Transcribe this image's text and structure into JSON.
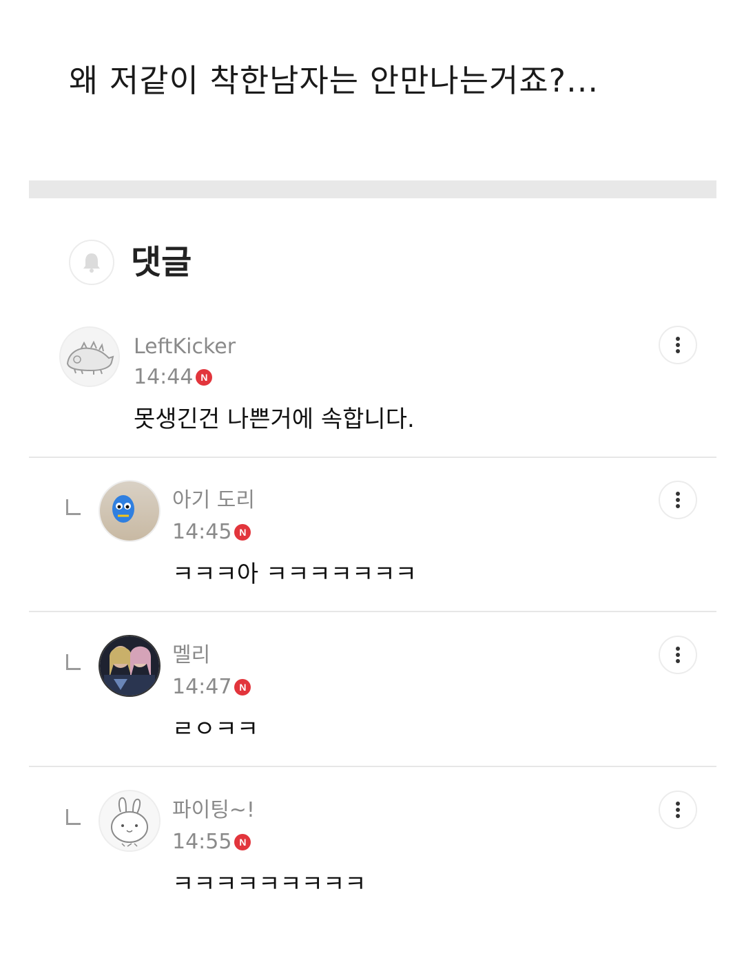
{
  "post": {
    "title": "왜 저같이 착한남자는 안만나는거죠?..."
  },
  "comments_section": {
    "title": "댓글"
  },
  "comments": [
    {
      "author": "LeftKicker",
      "time": "14:44",
      "badge": "N",
      "text": "못생긴건 나쁜거에 속합니다.",
      "is_reply": false
    },
    {
      "author": "아기 도리",
      "time": "14:45",
      "badge": "N",
      "text": "ㅋㅋㅋ아 ㅋㅋㅋㅋㅋㅋㅋ",
      "is_reply": true
    },
    {
      "author": "멜리",
      "time": "14:47",
      "badge": "N",
      "text": "ㄹㅇㅋㅋ",
      "is_reply": true
    },
    {
      "author": "파이팅~!",
      "time": "14:55",
      "badge": "N",
      "text": "ㅋㅋㅋㅋㅋㅋㅋㅋㅋ",
      "is_reply": true
    }
  ],
  "colors": {
    "badge": "#e2353c",
    "meta_text": "#8a8a8a",
    "divider": "#e6e6e6",
    "band": "#e8e8e8"
  },
  "icons": [
    "bell-icon",
    "more-vertical-icon",
    "new-badge-icon",
    "reply-indicator-icon"
  ]
}
